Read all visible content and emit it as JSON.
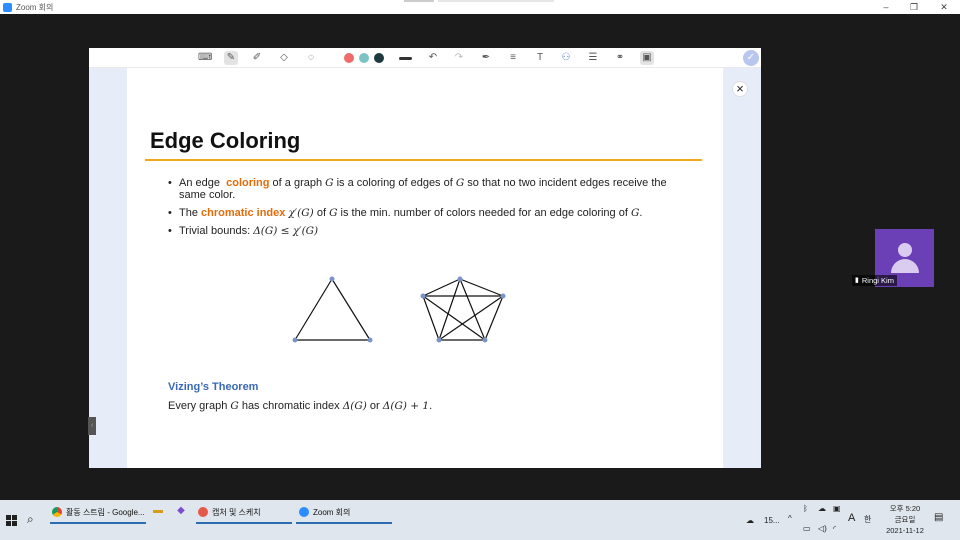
{
  "window": {
    "title": "Zoom 회의",
    "minimize": "–",
    "restore": "❐",
    "close": "✕"
  },
  "toolbar": {
    "icons": [
      "keyboard-icon",
      "pen-icon",
      "highlighter-icon",
      "eraser-icon",
      "lasso-icon",
      "line-icon",
      "undo-icon",
      "redo-icon",
      "format-icon",
      "text-align-icon",
      "text-icon",
      "shape-icon",
      "page-icon",
      "link-icon",
      "settings-icon"
    ],
    "colors": [
      "#ef6a6a",
      "#7cc4c4",
      "#1f3a3f"
    ]
  },
  "slide": {
    "title": "Edge Coloring",
    "bullet1_pre": "An edge ",
    "bullet1_hl": "coloring",
    "bullet1_mid": " of a graph ",
    "bullet1_g1": "G",
    "bullet1_mid2": " is a coloring of edges of ",
    "bullet1_g2": "G",
    "bullet1_post": " so that no two incident edges receive the same color.",
    "bullet2_pre": "The ",
    "bullet2_hl": "chromatic index",
    "bullet2_chi": "χ′(G)",
    "bullet2_mid": " of ",
    "bullet2_g": "G",
    "bullet2_post": " is the min. number of colors needed for an edge coloring of ",
    "bullet2_g2": "G",
    "bullet2_end": ".",
    "bullet3_pre": "Trivial bounds:  ",
    "bullet3_math": "Δ(G) ≤ χ′(G)",
    "theorem_title": "Vizing’s Theorem",
    "theorem_pre": "Every graph ",
    "theorem_g": "G",
    "theorem_mid": " has chromatic index ",
    "theorem_m1": "Δ(G)",
    "theorem_or": " or ",
    "theorem_m2": "Δ(G) + 1",
    "theorem_end": "."
  },
  "participant": {
    "name": "Ringi Kim"
  },
  "taskbar": {
    "item1": "활동 스트림 - Google...",
    "item2": "캡처 및 스케치",
    "item3": "Zoom 회의",
    "weather": "15...",
    "ime": "A",
    "ime2": "한",
    "time": "오후 5:20",
    "day": "금요일",
    "date": "2021-11-12"
  }
}
